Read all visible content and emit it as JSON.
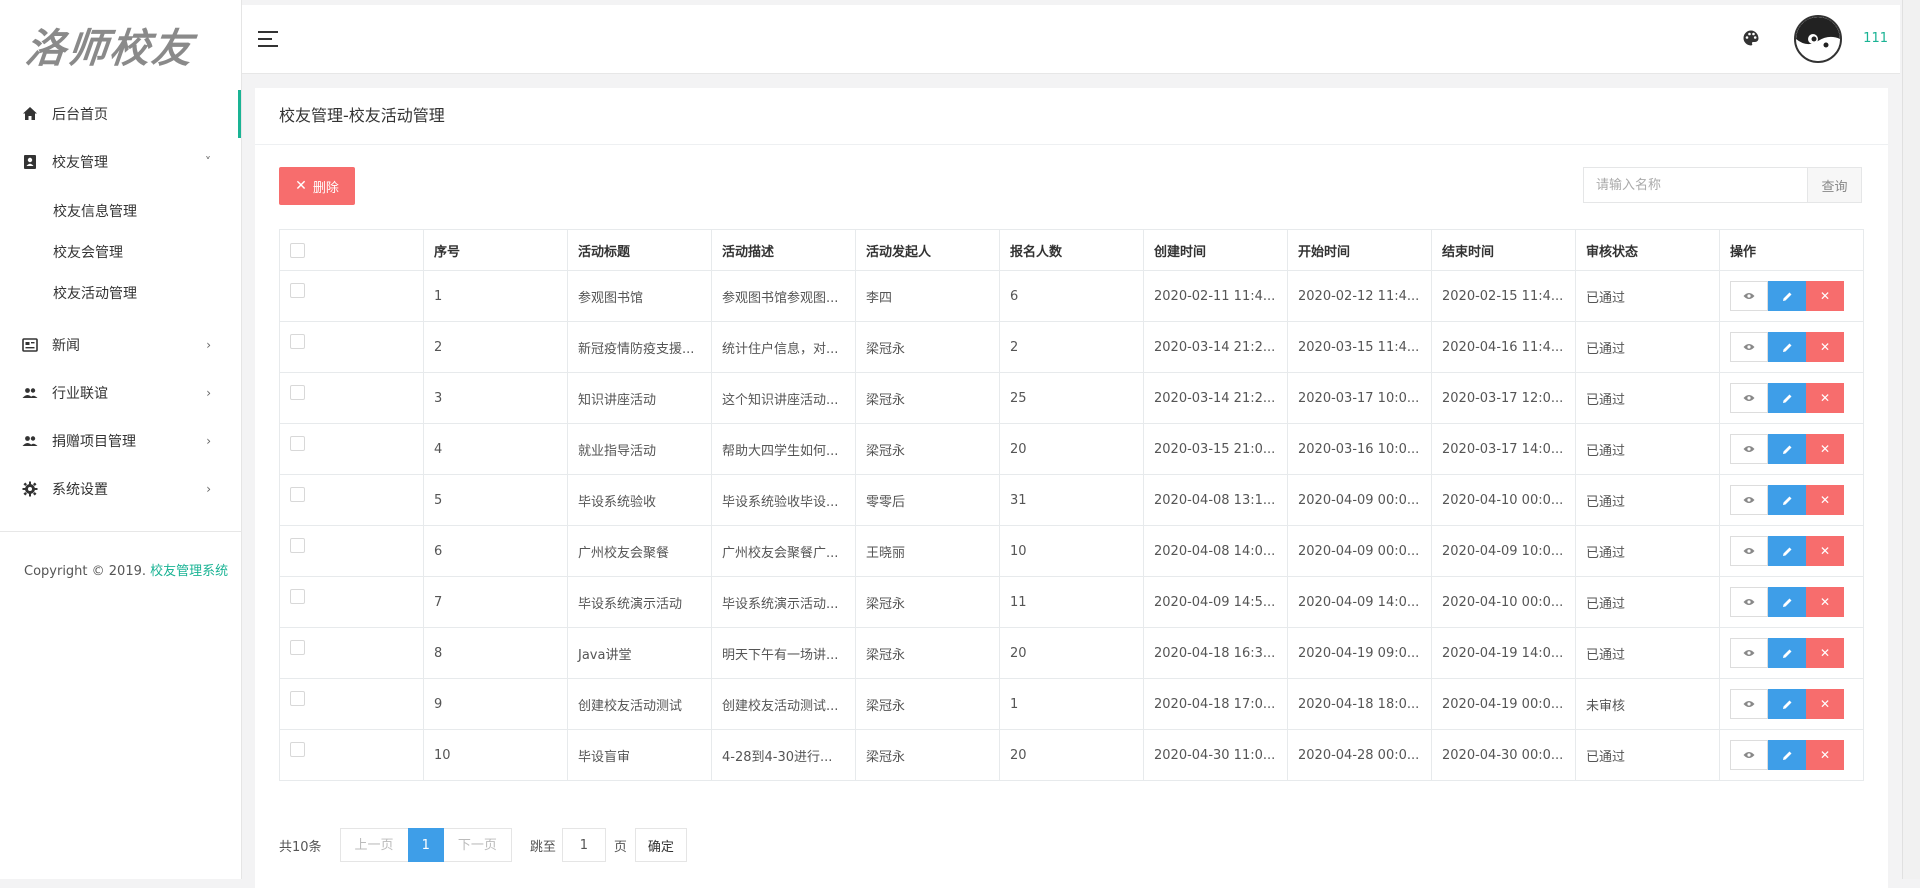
{
  "sidebar": {
    "logo_text": "洛师校友",
    "home_label": "后台首页",
    "alumni_mgmt_label": "校友管理",
    "sub_items": [
      "校友信息管理",
      "校友会管理",
      "校友活动管理"
    ],
    "news_label": "新闻",
    "industry_label": "行业联谊",
    "donation_label": "捐赠项目管理",
    "settings_label": "系统设置",
    "copyright_prefix": "Copyright © 2019.",
    "copyright_brand": "校友管理系统"
  },
  "header": {
    "username": "111"
  },
  "panel": {
    "title": "校友管理-校友活动管理",
    "delete_label": "删除",
    "search_placeholder": "请输入名称",
    "search_button": "查询"
  },
  "table": {
    "headers": {
      "index": "序号",
      "title": "活动标题",
      "desc": "活动描述",
      "initiator": "活动发起人",
      "count": "报名人数",
      "created": "创建时间",
      "start": "开始时间",
      "end": "结束时间",
      "status": "审核状态",
      "actions": "操作"
    },
    "rows": [
      {
        "index": "1",
        "title": "参观图书馆",
        "desc": "参观图书馆参观图...",
        "initiator": "李四",
        "count": "6",
        "created": "2020-02-11 11:4...",
        "start": "2020-02-12 11:4...",
        "end": "2020-02-15 11:4...",
        "status": "已通过"
      },
      {
        "index": "2",
        "title": "新冠疫情防疫支援...",
        "desc": "统计住户信息，对...",
        "initiator": "梁冠永",
        "count": "2",
        "created": "2020-03-14 21:2...",
        "start": "2020-03-15 11:4...",
        "end": "2020-04-16 11:4...",
        "status": "已通过"
      },
      {
        "index": "3",
        "title": "知识讲座活动",
        "desc": "这个知识讲座活动...",
        "initiator": "梁冠永",
        "count": "25",
        "created": "2020-03-14 21:2...",
        "start": "2020-03-17 10:0...",
        "end": "2020-03-17 12:0...",
        "status": "已通过"
      },
      {
        "index": "4",
        "title": "就业指导活动",
        "desc": "帮助大四学生如何...",
        "initiator": "梁冠永",
        "count": "20",
        "created": "2020-03-15 21:0...",
        "start": "2020-03-16 10:0...",
        "end": "2020-03-17 14:0...",
        "status": "已通过"
      },
      {
        "index": "5",
        "title": "毕设系统验收",
        "desc": "毕设系统验收毕设...",
        "initiator": "零零后",
        "count": "31",
        "created": "2020-04-08 13:1...",
        "start": "2020-04-09 00:0...",
        "end": "2020-04-10 00:0...",
        "status": "已通过"
      },
      {
        "index": "6",
        "title": "广州校友会聚餐",
        "desc": "广州校友会聚餐广...",
        "initiator": "王晓丽",
        "count": "10",
        "created": "2020-04-08 14:0...",
        "start": "2020-04-09 00:0...",
        "end": "2020-04-09 10:0...",
        "status": "已通过"
      },
      {
        "index": "7",
        "title": "毕设系统演示活动",
        "desc": "毕设系统演示活动...",
        "initiator": "梁冠永",
        "count": "11",
        "created": "2020-04-09 14:5...",
        "start": "2020-04-09 14:0...",
        "end": "2020-04-10 00:0...",
        "status": "已通过"
      },
      {
        "index": "8",
        "title": "Java讲堂",
        "desc": "明天下午有一场讲...",
        "initiator": "梁冠永",
        "count": "20",
        "created": "2020-04-18 16:3...",
        "start": "2020-04-19 09:0...",
        "end": "2020-04-19 14:0...",
        "status": "已通过"
      },
      {
        "index": "9",
        "title": "创建校友活动测试",
        "desc": "创建校友活动测试...",
        "initiator": "梁冠永",
        "count": "1",
        "created": "2020-04-18 17:0...",
        "start": "2020-04-18 18:0...",
        "end": "2020-04-19 00:0...",
        "status": "未审核"
      },
      {
        "index": "10",
        "title": "毕设盲审",
        "desc": "4-28到4-30进行...",
        "initiator": "梁冠永",
        "count": "20",
        "created": "2020-04-30 11:0...",
        "start": "2020-04-28 00:0...",
        "end": "2020-04-30 00:0...",
        "status": "已通过"
      }
    ]
  },
  "pagination": {
    "total": "共10条",
    "prev": "上一页",
    "current": "1",
    "next": "下一页",
    "jump_to": "跳至",
    "jump_value": "1",
    "page_unit": "页",
    "confirm": "确定"
  },
  "colors": {
    "accent": "#1ab394",
    "primary": "#3e9ee8",
    "danger": "#f76d6d"
  },
  "icons": [
    "home-icon",
    "contacts-icon",
    "news-icon",
    "group-icon",
    "settings-icon",
    "menu-icon",
    "palette-icon",
    "eye-icon",
    "pencil-icon",
    "close-icon"
  ]
}
